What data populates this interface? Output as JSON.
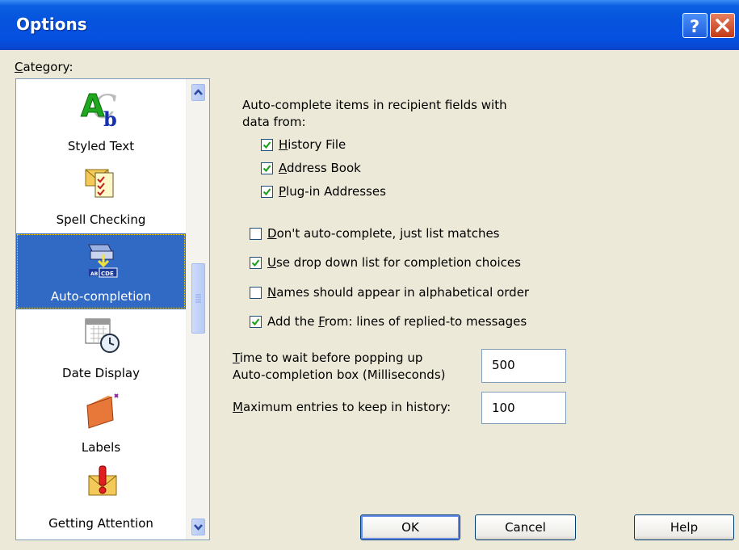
{
  "window": {
    "title": "Options"
  },
  "category_label": "Category:",
  "categories": [
    {
      "label": "Styled Text",
      "icon": "styled-text-icon",
      "selected": false
    },
    {
      "label": "Spell Checking",
      "icon": "spell-check-icon",
      "selected": false
    },
    {
      "label": "Auto-completion",
      "icon": "auto-completion-icon",
      "selected": true
    },
    {
      "label": "Date Display",
      "icon": "calendar-clock-icon",
      "selected": false
    },
    {
      "label": "Labels",
      "icon": "label-folder-icon",
      "selected": false
    },
    {
      "label": "Getting Attention",
      "icon": "attention-envelope-icon",
      "selected": false
    }
  ],
  "autocomplete": {
    "heading_line1": "Auto-complete items in recipient fields with",
    "heading_line2": "data from:",
    "sources": [
      {
        "label": "History File",
        "checked": true
      },
      {
        "label": "Address Book",
        "checked": true
      },
      {
        "label": "Plug-in Addresses",
        "checked": true
      }
    ],
    "options": [
      {
        "label": "Don't auto-complete, just list matches",
        "checked": false
      },
      {
        "label": "Use drop down list for completion choices",
        "checked": true
      },
      {
        "label": "Names should appear in alphabetical order",
        "checked": false
      },
      {
        "label": "Add the From: lines of replied-to messages",
        "checked": true
      }
    ],
    "wait_label_line1": "Time to wait before popping up",
    "wait_label_line2": "Auto-completion box (Milliseconds)",
    "wait_value": "500",
    "max_entries_label": "Maximum entries to keep in history:",
    "max_entries_value": "100"
  },
  "buttons": {
    "ok": "OK",
    "cancel": "Cancel",
    "help": "Help"
  },
  "colors": {
    "titlebar": "#0552dd",
    "selection": "#316ac5",
    "dialog_bg": "#ece9d8"
  }
}
